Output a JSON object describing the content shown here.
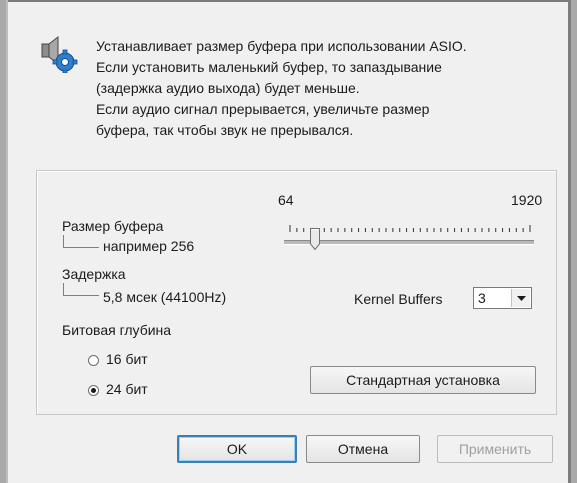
{
  "description": {
    "lines": [
      "Устанавливает размер буфера при использовании ASIO.",
      "Если установить маленький буфер, то запаздывание",
      "(задержка аудио выхода) будет меньше.",
      "Если аудио сигнал прерывается, увеличьте размер",
      "буфера, так чтобы звук не прерывался."
    ],
    "icon": "speaker-settings-icon"
  },
  "buffer": {
    "label": "Размер буфера",
    "example": "например 256",
    "min_label": "64",
    "max_label": "1920",
    "slider_value_fraction": 0.11
  },
  "latency": {
    "label": "Задержка",
    "value": "5,8 мсек (44100Hz)"
  },
  "kernel": {
    "label": "Kernel Buffers",
    "value": "3"
  },
  "bit_depth": {
    "label": "Битовая глубина",
    "options": [
      {
        "label": "16 бит",
        "selected": false
      },
      {
        "label": "24 бит",
        "selected": true
      }
    ]
  },
  "buttons": {
    "default_setup": "Стандартная установка",
    "ok": "OK",
    "cancel": "Отмена",
    "apply": "Применить"
  },
  "colors": {
    "dialog_bg": "#f0f0f0",
    "default_button_border": "#3c7fb1"
  }
}
